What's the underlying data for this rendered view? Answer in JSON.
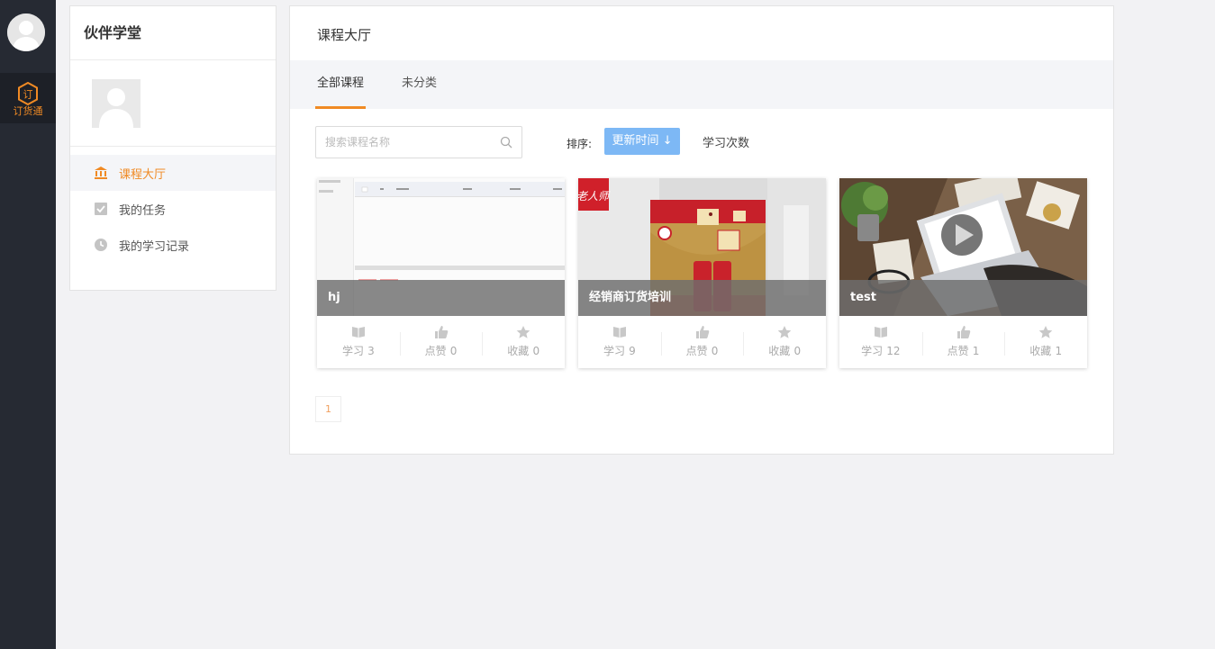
{
  "rail": {
    "app_label": "订货通",
    "app_icon_glyph": "订"
  },
  "sidebar": {
    "title": "伙伴学堂",
    "items": [
      {
        "label": "课程大厅",
        "icon": "bank-icon",
        "active": true
      },
      {
        "label": "我的任务",
        "icon": "checkbox-icon",
        "active": false
      },
      {
        "label": "我的学习记录",
        "icon": "clock-icon",
        "active": false
      }
    ]
  },
  "main": {
    "title": "课程大厅",
    "tabs": [
      {
        "label": "全部课程",
        "active": true
      },
      {
        "label": "未分类",
        "active": false
      }
    ],
    "search": {
      "placeholder": "搜索课程名称",
      "value": ""
    },
    "sort": {
      "label": "排序:",
      "active_option": "更新时间 ↓",
      "other_option": "学习次数"
    },
    "courses": [
      {
        "title": "hj",
        "study_label": "学习",
        "study_count": "3",
        "like_label": "点赞",
        "like_count": "0",
        "fav_label": "收藏",
        "fav_count": "0"
      },
      {
        "title": "经销商订货培训",
        "study_label": "学习",
        "study_count": "9",
        "like_label": "点赞",
        "like_count": "0",
        "fav_label": "收藏",
        "fav_count": "0"
      },
      {
        "title": "test",
        "study_label": "学习",
        "study_count": "12",
        "like_label": "点赞",
        "like_count": "1",
        "fav_label": "收藏",
        "fav_count": "1"
      }
    ],
    "pagination": {
      "current": "1"
    }
  },
  "colors": {
    "accent": "#f08a24",
    "sort_button": "#7db8f5",
    "rail_bg": "#262a33"
  }
}
